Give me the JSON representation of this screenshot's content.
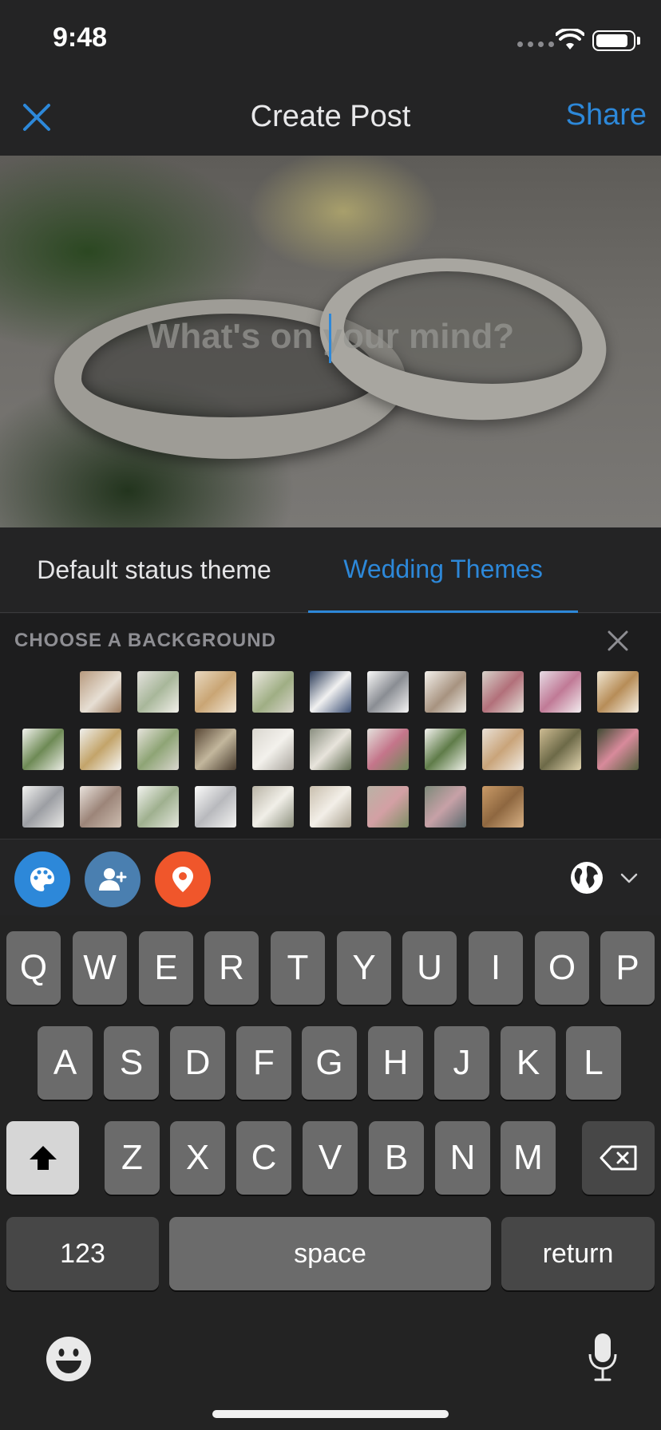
{
  "status_bar": {
    "time": "9:48"
  },
  "header": {
    "title": "Create Post",
    "share_label": "Share"
  },
  "composer": {
    "placeholder": "What's on your mind?"
  },
  "theme_tabs": [
    {
      "label": "Default status theme",
      "selected": false
    },
    {
      "label": "Wedding Themes",
      "selected": true
    }
  ],
  "background_chooser": {
    "label": "CHOOSE A BACKGROUND"
  },
  "keyboard": {
    "row1": [
      "Q",
      "W",
      "E",
      "R",
      "T",
      "Y",
      "U",
      "I",
      "O",
      "P"
    ],
    "row2": [
      "A",
      "S",
      "D",
      "F",
      "G",
      "H",
      "J",
      "K",
      "L"
    ],
    "row3": [
      "Z",
      "X",
      "C",
      "V",
      "B",
      "N",
      "M"
    ],
    "numbers_label": "123",
    "space_label": "space",
    "return_label": "return"
  },
  "colors": {
    "accent": "#2d88d9",
    "palette_button": "#2d88d9",
    "tag_button": "#4a7fb0",
    "location_button": "#f0562b"
  }
}
